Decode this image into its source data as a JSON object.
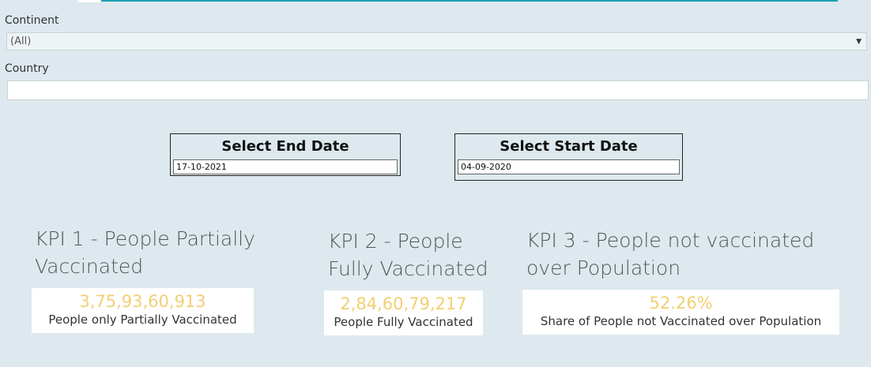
{
  "filters": {
    "continent": {
      "label": "Continent",
      "value": "(All)"
    },
    "country": {
      "label": "Country",
      "value": ""
    }
  },
  "dates": {
    "end": {
      "title": "Select End Date",
      "value": "17-10-2021"
    },
    "start": {
      "title": "Select Start Date",
      "value": "04-09-2020"
    }
  },
  "kpis": [
    {
      "title_line1": "KPI 1 - People Partially",
      "title_line2": "Vaccinated",
      "value": "3,75,93,60,913",
      "caption": "People only Partially Vaccinated"
    },
    {
      "title_line1": "KPI 2 - People",
      "title_line2": "Fully Vaccinated",
      "value": "2,84,60,79,217",
      "caption": "People Fully Vaccinated"
    },
    {
      "title_line1": "KPI 3 - People not vaccinated",
      "title_line2": "over Population",
      "value": "52.26%",
      "caption": "Share of People not Vaccinated over Population"
    }
  ],
  "icons": {
    "dropdown_caret": "caret-down-icon"
  },
  "colors": {
    "background": "#dde9ee",
    "accent": "#1d9fb4",
    "kpi_value": "#f2cf72"
  }
}
